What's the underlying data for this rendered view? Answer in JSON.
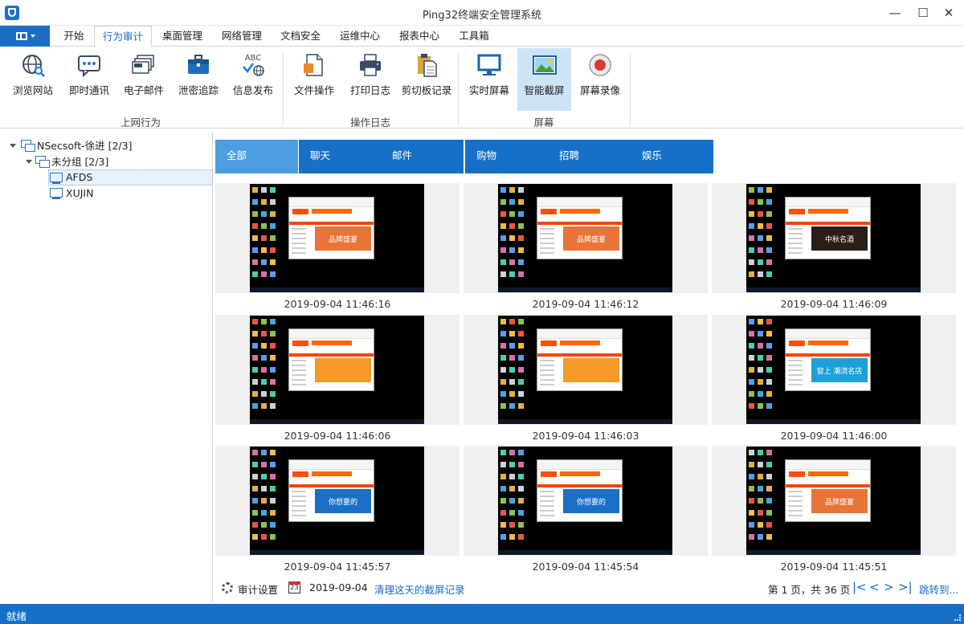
{
  "window": {
    "title": "Ping32终端安全管理系统",
    "min_label": "—",
    "max_label": "☐",
    "close_label": "✕"
  },
  "menu_tabs": [
    {
      "label": "开始"
    },
    {
      "label": "行为审计"
    },
    {
      "label": "桌面管理"
    },
    {
      "label": "网络管理"
    },
    {
      "label": "文档安全"
    },
    {
      "label": "运维中心"
    },
    {
      "label": "报表中心"
    },
    {
      "label": "工具箱"
    }
  ],
  "active_menu_tab": "行为审计",
  "ribbon": {
    "buttons": [
      {
        "label": "浏览网站",
        "icon": "globe-search-icon"
      },
      {
        "label": "即时通讯",
        "icon": "chat-bubble-icon"
      },
      {
        "label": "电子邮件",
        "icon": "mail-stack-icon"
      },
      {
        "label": "泄密追踪",
        "icon": "briefcase-icon"
      },
      {
        "label": "信息发布",
        "icon": "abc-globe-icon"
      },
      {
        "label": "文件操作",
        "icon": "file-icon"
      },
      {
        "label": "打印日志",
        "icon": "printer-icon"
      },
      {
        "label": "剪切板记录",
        "icon": "clipboard-icon"
      },
      {
        "label": "实时屏幕",
        "icon": "monitor-icon"
      },
      {
        "label": "智能截屏",
        "icon": "picture-icon"
      },
      {
        "label": "屏幕录像",
        "icon": "record-icon"
      }
    ],
    "active_button": "智能截屏",
    "groups": [
      {
        "label": "上网行为"
      },
      {
        "label": "操作日志"
      },
      {
        "label": "屏幕"
      }
    ]
  },
  "tree": {
    "root": {
      "label": "NSecsoft-徐进  [2/3]"
    },
    "group": {
      "label": "未分组  [2/3]"
    },
    "computers": [
      {
        "label": "AFDS"
      },
      {
        "label": "XUJIN"
      }
    ],
    "selected": "AFDS"
  },
  "categories": [
    {
      "label": "全部"
    },
    {
      "label": "聊天"
    },
    {
      "label": "邮件"
    },
    {
      "label": "购物"
    },
    {
      "label": "招聘"
    },
    {
      "label": "娱乐"
    }
  ],
  "active_category": "全部",
  "screenshots": [
    {
      "timestamp": "2019-09-04 11:46:16",
      "banner_text": "品牌盛宴",
      "banner_color": "#e8743a"
    },
    {
      "timestamp": "2019-09-04 11:46:12",
      "banner_text": "品牌盛宴",
      "banner_color": "#e8743a"
    },
    {
      "timestamp": "2019-09-04 11:46:09",
      "banner_text": "中秋名酒",
      "banner_color": "#2b1d18"
    },
    {
      "timestamp": "2019-09-04 11:46:06",
      "banner_text": "",
      "banner_color": "#f39a28"
    },
    {
      "timestamp": "2019-09-04 11:46:03",
      "banner_text": "",
      "banner_color": "#f39a28"
    },
    {
      "timestamp": "2019-09-04 11:46:00",
      "banner_text": "窗上 潮流名店",
      "banner_color": "#1ba1d8"
    },
    {
      "timestamp": "2019-09-04 11:45:57",
      "banner_text": "你想要的",
      "banner_color": "#1c6fc6"
    },
    {
      "timestamp": "2019-09-04 11:45:54",
      "banner_text": "你想要的",
      "banner_color": "#1c6fc6"
    },
    {
      "timestamp": "2019-09-04 11:45:51",
      "banner_text": "品牌盛宴",
      "banner_color": "#e8743a"
    }
  ],
  "bottom": {
    "audit_settings": "审计设置",
    "calendar_icon_day": "23",
    "date": "2019-09-04",
    "clear_link": "清理这天的截屏记录",
    "page_info": "第 1 页，共 36 页",
    "first": "|<",
    "prev": "<",
    "next": ">",
    "last": ">|",
    "jump": "跳转到..."
  },
  "status": {
    "text": "就绪"
  },
  "colors": {
    "accent": "#1670c8",
    "active_tab": "#4c9ee0",
    "selected_button": "#cde4f7"
  }
}
